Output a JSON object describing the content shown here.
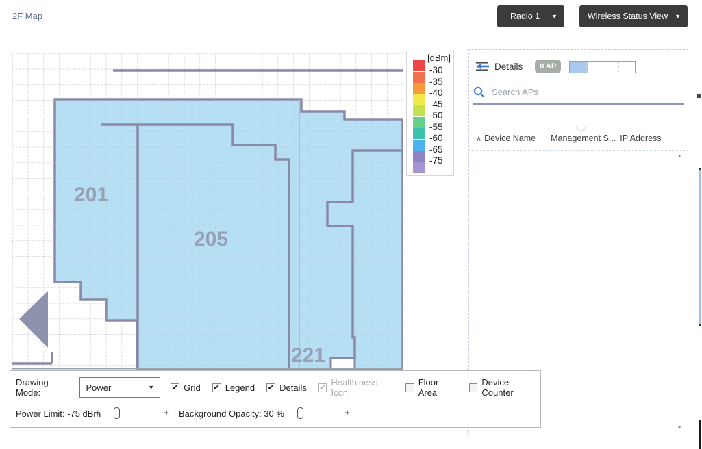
{
  "header": {
    "title": "2F Map",
    "radio_button_label": "Radio 1",
    "view_button_label": "Wireless Status View"
  },
  "icons": {
    "dropdown_arrow": "▼",
    "sort_asc": "∧",
    "scroll_up": "▲",
    "scroll_down": "▼",
    "checkmark": "✔",
    "slider_end": "+"
  },
  "map": {
    "rooms": [
      {
        "label": "201"
      },
      {
        "label": "205"
      },
      {
        "label": "221"
      }
    ],
    "overlay_color": "#aad9f2",
    "wall_color": "#8a8aa6",
    "grid_color": "#bfc4d2"
  },
  "legend": {
    "title": "[dBm]",
    "entries": [
      {
        "color": "#ee4545",
        "label": "-30"
      },
      {
        "color": "#f2714d",
        "label": "-35"
      },
      {
        "color": "#f59b3c",
        "label": "-40"
      },
      {
        "color": "#f2ea49",
        "label": "-45"
      },
      {
        "color": "#c3e24d",
        "label": "-50"
      },
      {
        "color": "#66d18c",
        "label": "-55"
      },
      {
        "color": "#3dc3ad",
        "label": "-60"
      },
      {
        "color": "#4cb2ef",
        "label": "-65"
      },
      {
        "color": "#8f83c3",
        "label": "-75"
      },
      {
        "color": "#a795cf",
        "label": ""
      }
    ]
  },
  "details_panel": {
    "title": "Details",
    "ap_badge": "0 AP",
    "progress_percent": 27,
    "progress_fill_color": "#a9c8ef",
    "search_placeholder": "Search APs",
    "columns": [
      "Device Name",
      "Management S...",
      "IP Address"
    ]
  },
  "toolbar": {
    "drawing_mode_label": "Drawing Mode:",
    "drawing_mode_value": "Power",
    "checkboxes": [
      {
        "label": "Grid",
        "checked": true,
        "disabled": false
      },
      {
        "label": "Legend",
        "checked": true,
        "disabled": false
      },
      {
        "label": "Details",
        "checked": true,
        "disabled": false
      },
      {
        "label": "Healthiness Icon",
        "checked": true,
        "disabled": true
      },
      {
        "label": "Floor Area",
        "checked": false,
        "disabled": false
      },
      {
        "label": "Device Counter",
        "checked": false,
        "disabled": false
      }
    ],
    "power_limit_label": "Power Limit: -75 dBm",
    "power_limit_percent": 24,
    "opacity_label": "Background Opacity: 30 %",
    "opacity_percent": 28
  }
}
